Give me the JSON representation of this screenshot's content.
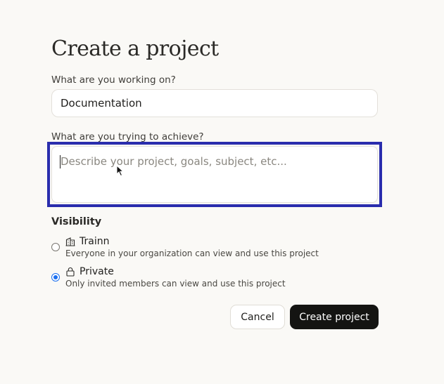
{
  "page": {
    "title": "Create a project"
  },
  "form": {
    "working_on": {
      "label": "What are you working on?",
      "value": "Documentation"
    },
    "achieve": {
      "label": "What are you trying to achieve?",
      "placeholder": "Describe your project, goals, subject, etc..."
    },
    "visibility": {
      "heading": "Visibility",
      "options": [
        {
          "icon": "building-icon",
          "label": "Trainn",
          "description": "Everyone in your organization can view and use this project",
          "selected": false
        },
        {
          "icon": "lock-icon",
          "label": "Private",
          "description": "Only invited members can view and use this project",
          "selected": true
        }
      ]
    }
  },
  "actions": {
    "cancel_label": "Cancel",
    "create_label": "Create project"
  },
  "colors": {
    "highlight": "#2a2dad",
    "radio_selected": "#1a6ff0",
    "primary_button": "#141412",
    "background": "#faf9f6"
  }
}
